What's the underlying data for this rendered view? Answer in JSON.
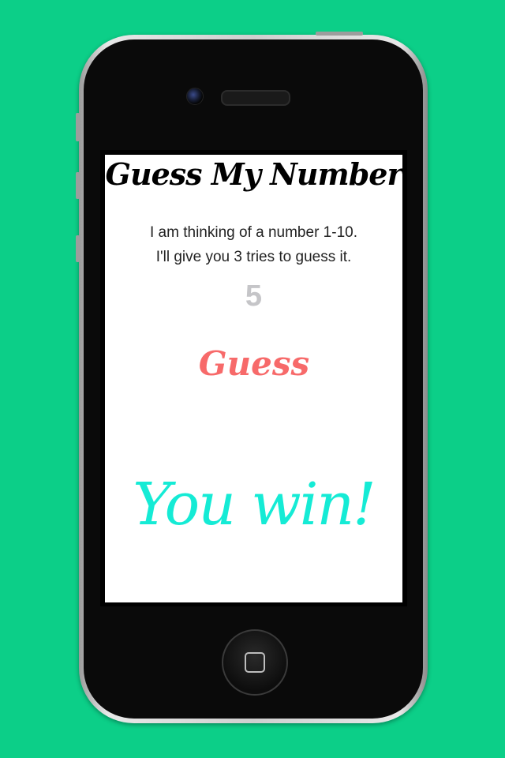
{
  "app": {
    "title": "Guess My Number",
    "intro_line1": "I am thinking of a number 1-10.",
    "intro_line2": "I'll give you 3 tries to guess it.",
    "guess_value": "5",
    "guess_button_label": "Guess",
    "result_message": "You win!"
  },
  "colors": {
    "background": "#0ccf88",
    "guess_button": "#f76a6a",
    "result_text": "#15ebd5",
    "number_text": "#c5c5c8"
  }
}
